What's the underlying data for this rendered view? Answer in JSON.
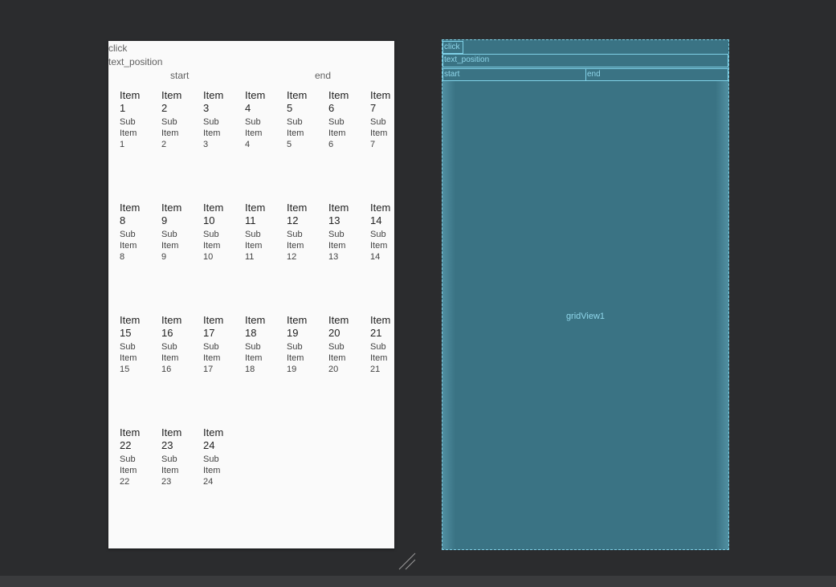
{
  "preview": {
    "click_text": "click",
    "position_text": "text_position",
    "start_text": "start",
    "end_text": "end"
  },
  "grid_items": [
    {
      "title": "Item 1",
      "subtitle": "Sub Item 1"
    },
    {
      "title": "Item 2",
      "subtitle": "Sub Item 2"
    },
    {
      "title": "Item 3",
      "subtitle": "Sub Item 3"
    },
    {
      "title": "Item 4",
      "subtitle": "Sub Item 4"
    },
    {
      "title": "Item 5",
      "subtitle": "Sub Item 5"
    },
    {
      "title": "Item 6",
      "subtitle": "Sub Item 6"
    },
    {
      "title": "Item 7",
      "subtitle": "Sub Item 7"
    },
    {
      "title": "Item 8",
      "subtitle": "Sub Item 8"
    },
    {
      "title": "Item 9",
      "subtitle": "Sub Item 9"
    },
    {
      "title": "Item 10",
      "subtitle": "Sub Item 10"
    },
    {
      "title": "Item 11",
      "subtitle": "Sub Item 11"
    },
    {
      "title": "Item 12",
      "subtitle": "Sub Item 12"
    },
    {
      "title": "Item 13",
      "subtitle": "Sub Item 13"
    },
    {
      "title": "Item 14",
      "subtitle": "Sub Item 14"
    },
    {
      "title": "Item 15",
      "subtitle": "Sub Item 15"
    },
    {
      "title": "Item 16",
      "subtitle": "Sub Item 16"
    },
    {
      "title": "Item 17",
      "subtitle": "Sub Item 17"
    },
    {
      "title": "Item 18",
      "subtitle": "Sub Item 18"
    },
    {
      "title": "Item 19",
      "subtitle": "Sub Item 19"
    },
    {
      "title": "Item 20",
      "subtitle": "Sub Item 20"
    },
    {
      "title": "Item 21",
      "subtitle": "Sub Item 21"
    },
    {
      "title": "Item 22",
      "subtitle": "Sub Item 22"
    },
    {
      "title": "Item 23",
      "subtitle": "Sub Item 23"
    },
    {
      "title": "Item 24",
      "subtitle": "Sub Item 24"
    }
  ],
  "blueprint": {
    "click_label": "click",
    "position_label": "text_position",
    "start_label": "start",
    "end_label": "end",
    "grid_label": "gridView1"
  },
  "colors": {
    "editor_background": "#2b2c2e",
    "preview_background": "#fafafa",
    "blueprint_fill": "#3a7384",
    "blueprint_outline": "#7fd0e6"
  },
  "icons": {
    "resize_handle": "resize-handle-icon"
  }
}
